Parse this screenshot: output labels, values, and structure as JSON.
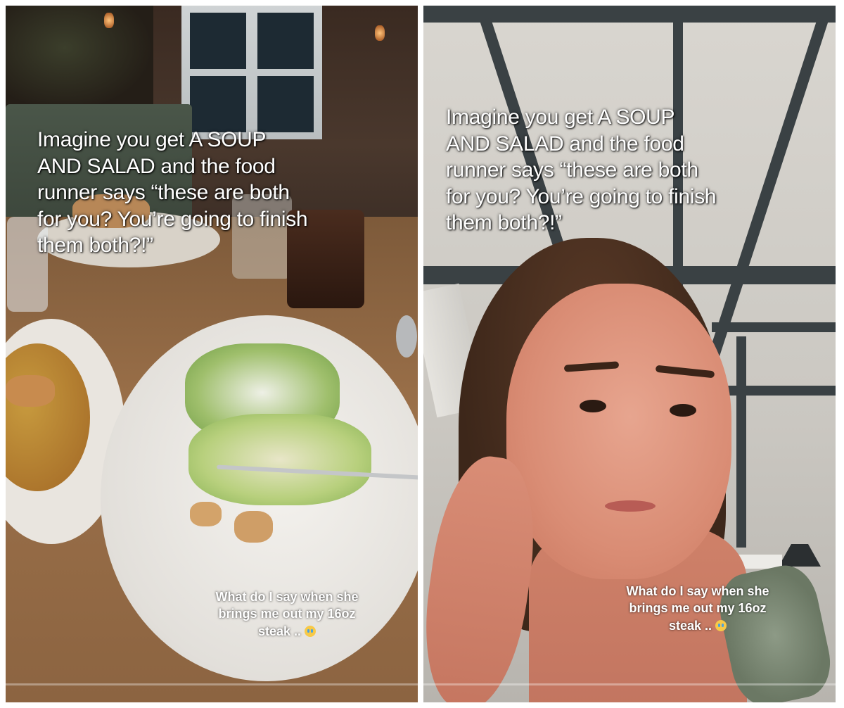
{
  "panels": [
    {
      "caption_lines": [
        "Imagine you get A SOUP",
        "AND SALAD and the food",
        "runner says “these are both",
        "for you? You’re going to finish",
        "them both?!”"
      ],
      "subcaption_lines": [
        "What do I say when she",
        "brings me out my 16oz",
        "steak .."
      ],
      "subcaption_emoji": "crying-face-icon",
      "progress": 0
    },
    {
      "caption_lines": [
        "Imagine you get A SOUP",
        "AND SALAD and the food",
        "runner says “these are both",
        "for you? You’re going to finish",
        "them both?!”"
      ],
      "subcaption_lines": [
        "What do I say when she",
        "brings me out my 16oz",
        "steak .."
      ],
      "subcaption_emoji": "crying-face-icon",
      "progress": 0
    }
  ],
  "colors": {
    "caption_text": "#ffffff",
    "wood_table": "#9b7049",
    "plate": "#f4f2ee",
    "ceiling": "#d9d6d0",
    "beams": "#3a4144"
  }
}
